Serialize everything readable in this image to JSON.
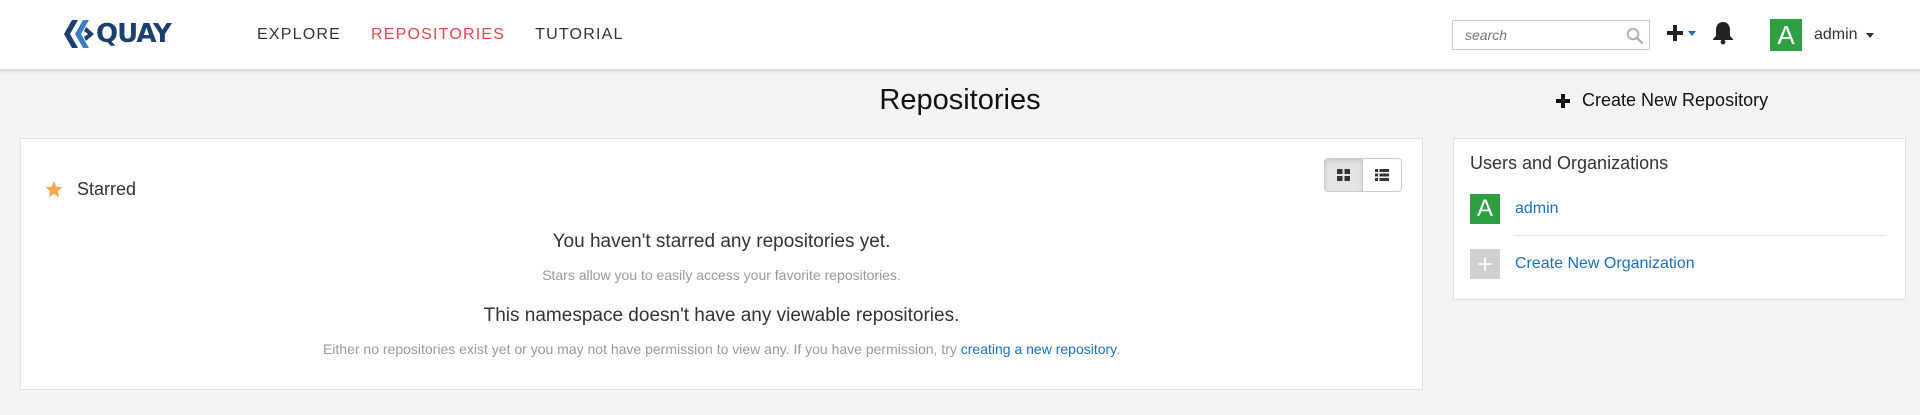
{
  "brand": {
    "name": "QUAY"
  },
  "nav": {
    "items": [
      {
        "label": "EXPLORE",
        "active": false
      },
      {
        "label": "REPOSITORIES",
        "active": true
      },
      {
        "label": "TUTORIAL",
        "active": false
      }
    ]
  },
  "search": {
    "placeholder": "search",
    "value": ""
  },
  "user": {
    "name": "admin",
    "avatar_letter": "A"
  },
  "page": {
    "title": "Repositories",
    "create_label": "Create New Repository"
  },
  "starred": {
    "label": "Starred"
  },
  "empty_state": {
    "starred_title": "You haven't starred any repositories yet.",
    "starred_sub": "Stars allow you to easily access your favorite repositories.",
    "namespace_title": "This namespace doesn't have any viewable repositories.",
    "namespace_sub_prefix": "Either no repositories exist yet or you may not have permission to view any. If you have permission, try ",
    "namespace_sub_link": "creating a new repository",
    "namespace_sub_suffix": "."
  },
  "side_panel": {
    "title": "Users and Organizations",
    "items": [
      {
        "label": "admin",
        "avatar_letter": "A"
      },
      {
        "label": "Create New Organization",
        "avatar_letter": "+"
      }
    ]
  },
  "colors": {
    "accent_red": "#e0464f",
    "link_blue": "#1a6fc1",
    "avatar_green": "#2ea043",
    "star_orange": "#f5a54a",
    "brand_navy": "#1d3f6e"
  }
}
